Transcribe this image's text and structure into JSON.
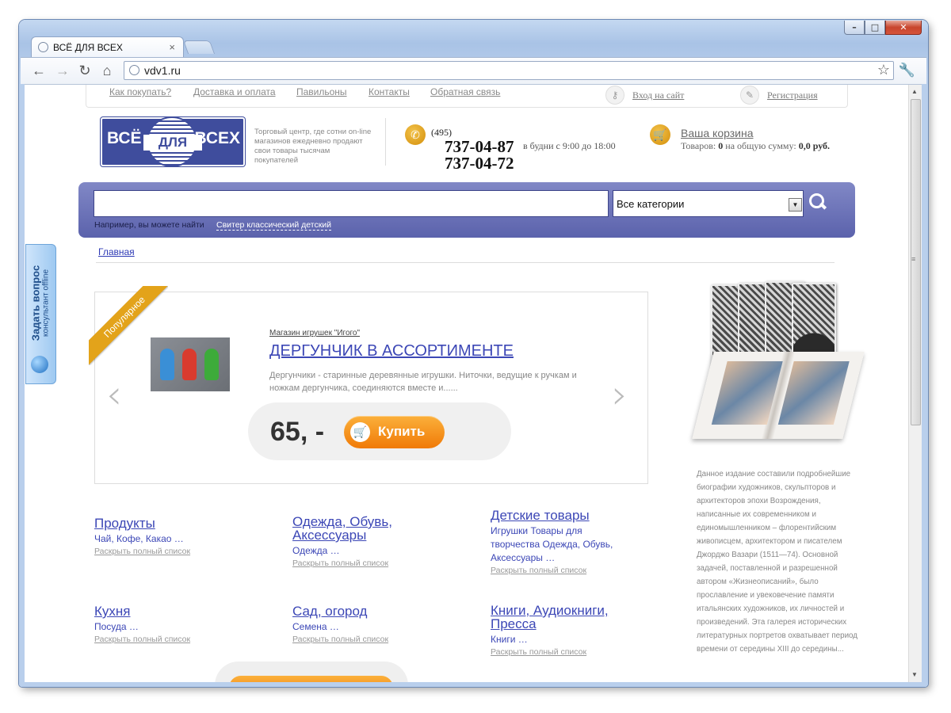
{
  "browser": {
    "tab_title": "ВСЁ ДЛЯ ВСЕХ",
    "tab_close": "×",
    "url": "vdv1.ru"
  },
  "toplinks": {
    "how_to_buy": "Как покупать?",
    "delivery": "Доставка и оплата",
    "pavilions": "Павильоны",
    "contacts": "Контакты",
    "feedback": "Обратная связь",
    "login": "Вход на сайт",
    "register": "Регистрация"
  },
  "header": {
    "logo_left": "ВСЁ",
    "logo_mid": "ДЛЯ",
    "logo_right": "ВСЕХ",
    "tagline": "Торговый центр, где сотни on-line магазинов ежедневно продают свои товары тысячам покупателей",
    "phone_code": "(495)",
    "phone_1": "737-04-87",
    "phone_2": "737-04-72",
    "hours": "в будни с 9:00 до 18:00",
    "cart_title": "Ваша корзина",
    "cart_prefix": "Товаров: ",
    "cart_count": "0",
    "cart_mid": " на общую сумму: ",
    "cart_sum": "0,0 руб."
  },
  "search": {
    "query": "",
    "category": "Все категории",
    "hint": "Например, вы можете найти",
    "example": "Свитер классический детский"
  },
  "breadcrumb": {
    "home": "Главная"
  },
  "feedback_widget": {
    "title": "Задать вопрос",
    "subtitle": "консультант offline"
  },
  "promo": {
    "ribbon": "Популярное",
    "shop": "Магазин игрушек \"Игого\"",
    "title": "ДЕРГУНЧИК В АССОРТИМЕНТЕ",
    "description": "Дергунчики - старинные деревянные игрушки. Ниточки, ведущие к ручкам и ножкам дергунчика, соединяются вместе и......",
    "price": "65, -",
    "buy_label": "Купить"
  },
  "categories": [
    {
      "title": "Продукты",
      "items": "Чай, Кофе, Какао …",
      "more": "Раскрыть полный список"
    },
    {
      "title": "Одежда, Обувь, Аксессуары",
      "items": "Одежда …",
      "more": "Раскрыть полный список"
    },
    {
      "title": "Детские товары",
      "items": "Игрушки Товары для творчества Одежда, Обувь, Аксессуары …",
      "more": "Раскрыть полный список"
    },
    {
      "title": "Кухня",
      "items": "Посуда …",
      "more": "Раскрыть полный список"
    },
    {
      "title": "Сад, огород",
      "items": "Семена …",
      "more": "Раскрыть полный список"
    },
    {
      "title": "Книги, Аудиокниги, Пресса",
      "items": "Книги …",
      "more": "Раскрыть полный список"
    }
  ],
  "side_book": {
    "description": "Данное издание составили подробнейшие биографии художников, скульпторов и архитекторов эпохи Возрождения, написанные их современником и единомышленником – флорентийским живописцем, архитектором и писателем Джорджо Вазари (1511—74). Основной задачей, поставленной и разрешенной автором «Жизнеописаний», было прославление и увековечение памяти итальянских художников, их личностей и произведений. Эта галерея исторических литературных портретов охватывает период времени от середины XIII до середины..."
  }
}
